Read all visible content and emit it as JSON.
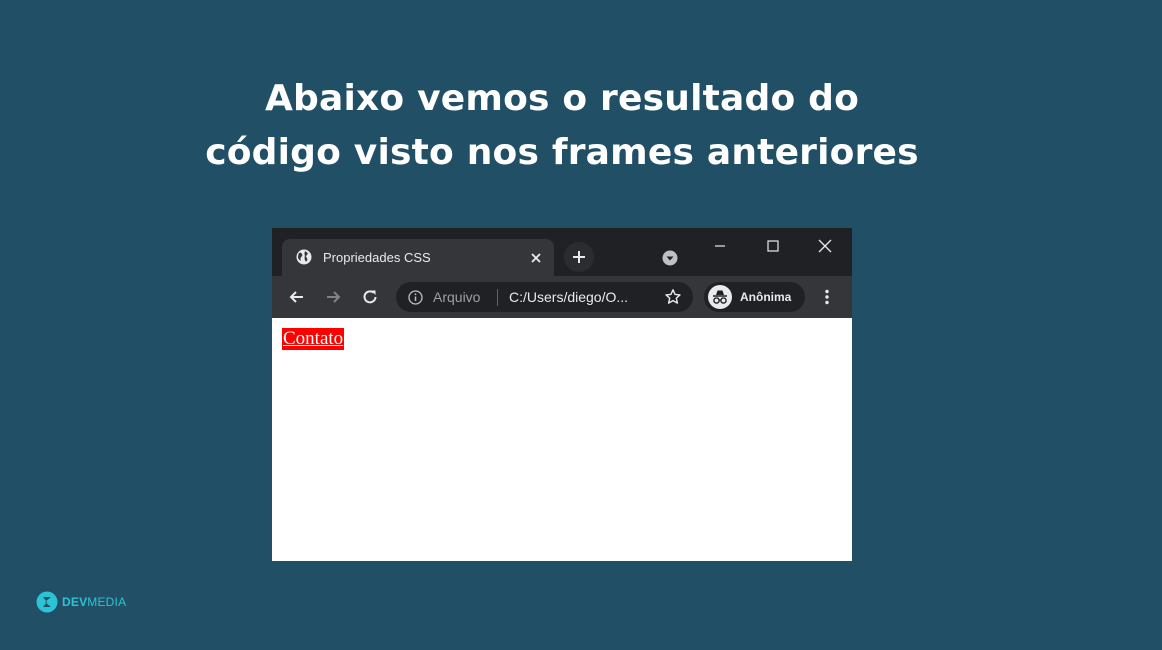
{
  "slide": {
    "headline_line1": "Abaixo vemos o resultado do",
    "headline_line2": "código visto nos frames anteriores"
  },
  "browser": {
    "tab_title": "Propriedades CSS",
    "omnibox": {
      "scheme_label": "Arquivo",
      "url": "C:/Users/diego/O..."
    },
    "profile_label": "Anônima",
    "page": {
      "link_text": "Contato",
      "link_background": "#ff0000",
      "link_color": "#ffffff"
    },
    "icons": {
      "tab": [
        "globe-icon",
        "close-icon"
      ],
      "tabstrip": [
        "plus-icon",
        "tab-search-icon"
      ],
      "window": [
        "minimize-icon",
        "maximize-icon",
        "close-window-icon"
      ],
      "toolbar": [
        "back-arrow-icon",
        "forward-arrow-icon",
        "reload-icon",
        "info-icon",
        "star-icon",
        "incognito-icon",
        "more-vertical-icon"
      ]
    }
  },
  "brand": {
    "dev": "DEV",
    "media": "MEDIA",
    "icon": "devmedia-logo-icon"
  },
  "colors": {
    "background": "#215066",
    "headline": "#ffffff",
    "chrome_dark": "#202124",
    "chrome_tab": "#35363a",
    "brand_accent": "#2bc4d6"
  }
}
